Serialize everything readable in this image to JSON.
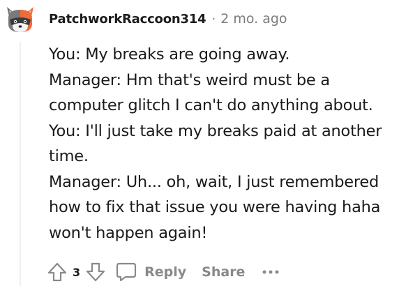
{
  "comment": {
    "username": "PatchworkRaccoon314",
    "separator": "·",
    "timestamp": "2 mo. ago",
    "avatar_icon": "raccoon-avatar-icon",
    "body_lines": [
      "You: My breaks are going away.",
      "Manager: Hm that's weird must be a",
      "computer glitch I can't do anything about.",
      "You: I'll just take my breaks paid at another",
      "time.",
      "Manager: Uh... oh, wait, I just remembered",
      "how to fix that issue you were having haha",
      "won't happen again!"
    ]
  },
  "actions": {
    "upvote_icon": "upvote-arrow-icon",
    "vote_count": "3",
    "downvote_icon": "downvote-arrow-icon",
    "reply_icon": "speech-bubble-icon",
    "reply_label": "Reply",
    "share_label": "Share",
    "more_icon": "ellipsis-icon"
  },
  "colors": {
    "text": "#1a1a1b",
    "muted": "#878a8c",
    "avatar_orange": "#f06a3a",
    "thread_line": "#edeff1"
  }
}
